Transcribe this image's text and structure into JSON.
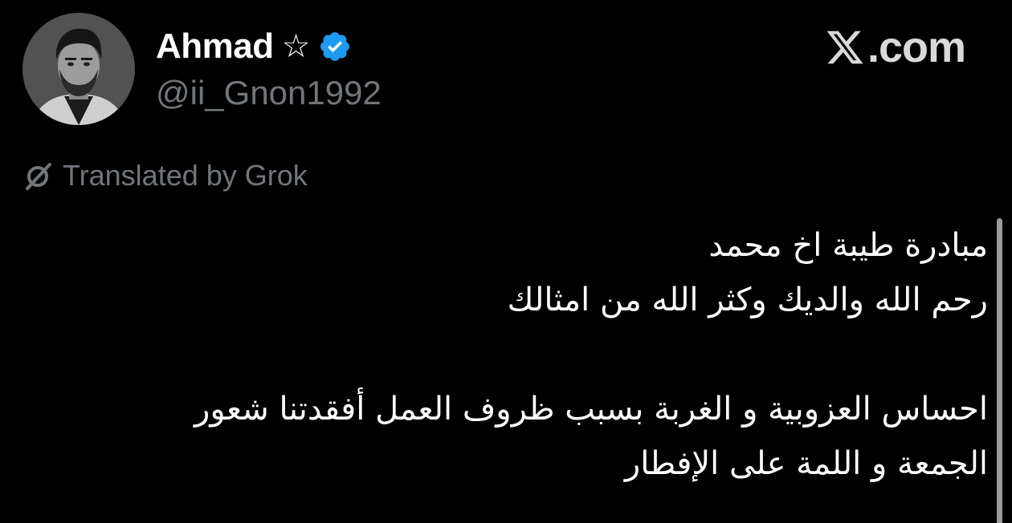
{
  "author": {
    "display_name": "Ahmad",
    "name_symbol": "☆",
    "handle": "@ii_Gnon1992",
    "verified": true,
    "verified_color": "#1d9bf0",
    "avatar_icon": "profile-photo"
  },
  "brand": {
    "label": ".com",
    "logo_icon": "x-logo-icon"
  },
  "translation": {
    "label": "Translated by Grok",
    "icon": "grok-icon"
  },
  "tweet": {
    "paragraph_1": {
      "line_1": "مبادرة طيبة اخ محمد",
      "line_2": "رحم الله والديك وكثر الله من امثالك"
    },
    "paragraph_2": {
      "line_1": "احساس العزوبية و الغربة بسبب ظروف العمل أفقدتنا شعور",
      "line_2": "الجمعة و اللمة على الإفطار"
    }
  },
  "colors": {
    "background": "#000000",
    "primary_text": "#ffffff",
    "secondary_text": "#71767b"
  }
}
